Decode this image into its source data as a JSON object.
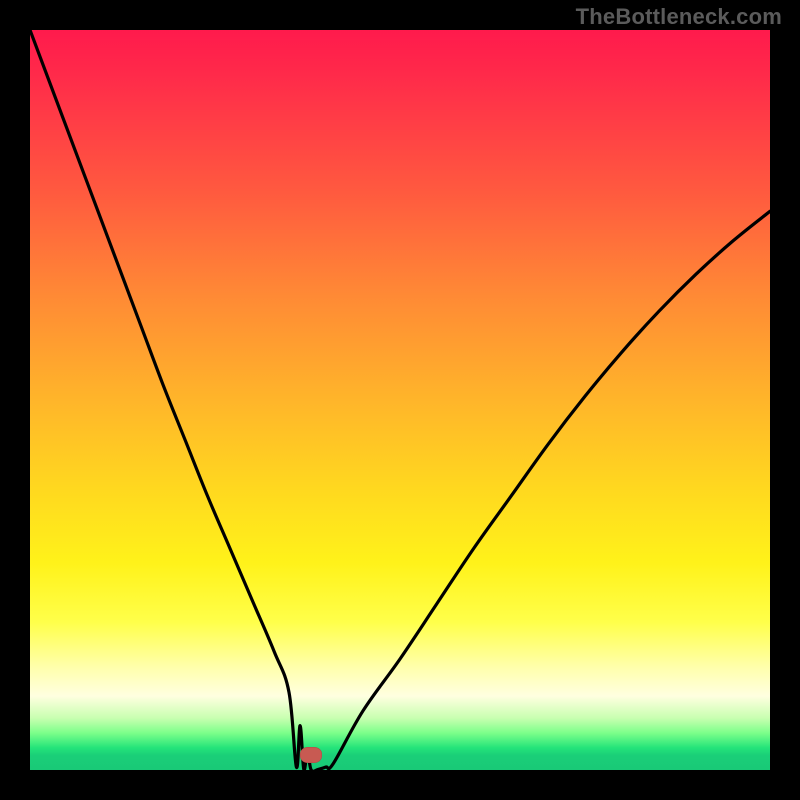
{
  "watermark": "TheBottleneck.com",
  "colors": {
    "frame_bg": "#000000",
    "curve": "#000000",
    "marker": "#c85a52",
    "gradient_stops": [
      "#ff1a4c",
      "#ff5a3f",
      "#ffb52a",
      "#fff21a",
      "#ffffaa",
      "#c8ffb0",
      "#24e47a",
      "#19c977"
    ]
  },
  "chart_data": {
    "type": "line",
    "title": "",
    "xlabel": "",
    "ylabel": "",
    "xlim": [
      0,
      100
    ],
    "ylim": [
      0,
      100
    ],
    "note": "V-shaped bottleneck curve; minimum at x≈38 y≈0. Left branch steeper than right branch. Background vertical gradient red→green indicates good (bottom) to bad (top).",
    "marker": {
      "x": 38,
      "y": 2
    },
    "series": [
      {
        "name": "left-branch",
        "x": [
          0,
          3,
          6,
          9,
          12,
          15,
          18,
          21,
          24,
          27,
          30,
          33,
          35,
          36.5,
          37.5,
          38
        ],
        "y": [
          100,
          92,
          84,
          76,
          68,
          60,
          52,
          44.5,
          37,
          30,
          23,
          16,
          10.5,
          6,
          2.5,
          0
        ]
      },
      {
        "name": "flat-min",
        "x": [
          35,
          36,
          37,
          38,
          39,
          40,
          41
        ],
        "y": [
          0.8,
          0.4,
          0.1,
          0,
          0.1,
          0.4,
          0.9
        ]
      },
      {
        "name": "right-branch",
        "x": [
          38,
          41,
          45,
          50,
          55,
          60,
          65,
          70,
          75,
          80,
          85,
          90,
          95,
          100
        ],
        "y": [
          0,
          3,
          8,
          15,
          22.5,
          30,
          37,
          44,
          50.5,
          56.5,
          62,
          67,
          71.5,
          75.5
        ]
      }
    ]
  }
}
